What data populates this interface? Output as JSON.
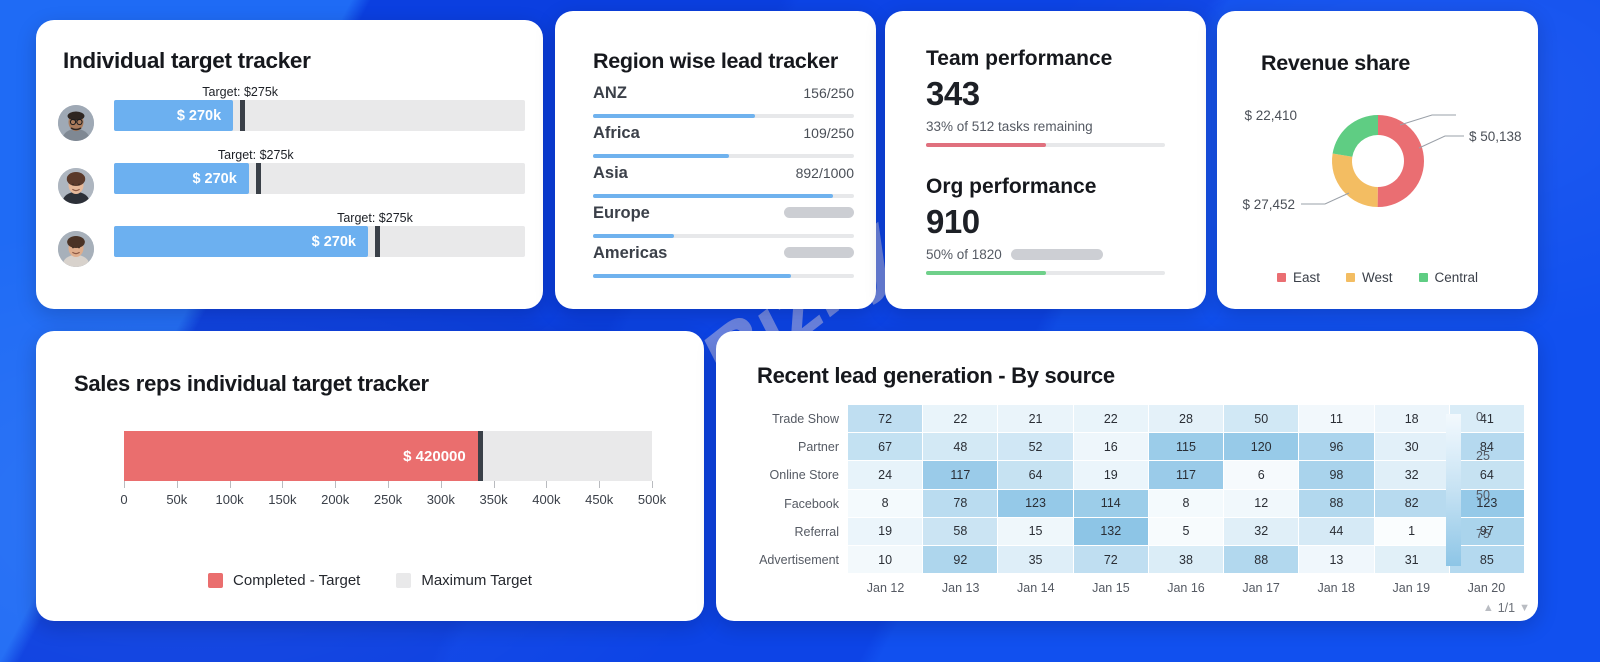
{
  "watermark": "Bizfly",
  "theme": {
    "bg_blue": "#0b45e8",
    "blue_bar": "#6cb0f0",
    "red_bar": "#ea6e6e",
    "green_bar": "#6fd08a",
    "track_grey": "#e9e9ea",
    "marker_dark": "#3a4048"
  },
  "individual_tracker": {
    "title": "Individual target tracker",
    "rows": [
      {
        "avatar": "avatar-man-glasses",
        "target_label": "Target: $275k",
        "value_label": "$ 270k",
        "fill_pct": 29.0,
        "marker_pct": 30.7
      },
      {
        "avatar": "avatar-woman-dark-blazer",
        "target_label": "Target: $275k",
        "value_label": "$ 270k",
        "fill_pct": 32.8,
        "marker_pct": 34.5
      },
      {
        "avatar": "avatar-woman-smiling",
        "target_label": "Target: $275k",
        "value_label": "$ 270k",
        "fill_pct": 61.8,
        "marker_pct": 63.5
      }
    ]
  },
  "region_tracker": {
    "title": "Region wise lead tracker",
    "rows": [
      {
        "name": "ANZ",
        "value": "156/250",
        "fill_pct": 62,
        "loading": false
      },
      {
        "name": "Africa",
        "value": "109/250",
        "fill_pct": 52,
        "loading": false
      },
      {
        "name": "Asia",
        "value": "892/1000",
        "fill_pct": 92,
        "loading": false
      },
      {
        "name": "Europe",
        "value": "",
        "fill_pct": 31,
        "loading": true
      },
      {
        "name": "Americas",
        "value": "",
        "fill_pct": 76,
        "loading": true
      }
    ]
  },
  "performance": {
    "team": {
      "title": "Team performance",
      "number": "343",
      "subtitle": "33% of 512 tasks remaining",
      "fill_pct": 50,
      "color": "#e0707e",
      "loading": false
    },
    "org": {
      "title": "Org performance",
      "number": "910",
      "subtitle": "50% of 1820",
      "fill_pct": 50,
      "color": "#6fd08a",
      "loading": true
    }
  },
  "revenue_share": {
    "title": "Revenue share",
    "legend": [
      {
        "label": "East",
        "color": "#ea6e72"
      },
      {
        "label": "West",
        "color": "#f3bd62"
      },
      {
        "label": "Central",
        "color": "#5fcd83"
      }
    ],
    "callouts": {
      "east": "$ 50,138",
      "west": "$ 27,452",
      "central": "$ 22,410"
    },
    "chart_data": {
      "type": "pie",
      "title": "Revenue share",
      "categories": [
        "East",
        "West",
        "Central"
      ],
      "values": [
        50138,
        27452,
        22410
      ],
      "labels": [
        "$ 50,138",
        "$ 27,452",
        "$ 22,410"
      ],
      "colors": [
        "#ea6e72",
        "#f3bd62",
        "#5fcd83"
      ],
      "donut": true,
      "legend_position": "bottom"
    }
  },
  "sales_reps": {
    "title": "Sales reps individual target tracker",
    "bar_label": "$ 420000",
    "legend": [
      {
        "label": "Completed - Target",
        "color": "#ea6e6e"
      },
      {
        "label": "Maximum Target",
        "color": "#e9e9ea"
      }
    ],
    "chart_data": {
      "type": "bar",
      "orientation": "horizontal",
      "title": "Sales reps individual target tracker",
      "categories": [
        "Completed - Target"
      ],
      "values": [
        420000
      ],
      "value_labels": [
        "$ 420000"
      ],
      "bar_end_pct": 67,
      "marker_pct": 67,
      "xlim": [
        0,
        500000
      ],
      "xticks": [
        0,
        50000,
        100000,
        150000,
        200000,
        250000,
        300000,
        350000,
        400000,
        450000,
        500000
      ],
      "xticklabels": [
        "0",
        "50k",
        "100k",
        "150k",
        "200k",
        "250k",
        "300k",
        "350k",
        "400k",
        "450k",
        "500k"
      ],
      "ylabel": "",
      "xlabel": "",
      "grid": false,
      "legend_position": "bottom"
    }
  },
  "lead_generation": {
    "title": "Recent lead generation - By source",
    "pager": {
      "up": "▲",
      "text": "1/1",
      "down": "▼"
    },
    "scale": {
      "labels": [
        "0",
        "25",
        "50",
        "75"
      ]
    },
    "chart_data": {
      "type": "heatmap",
      "title": "Recent lead generation - By source",
      "rows": [
        "Trade Show",
        "Partner",
        "Online Store",
        "Facebook",
        "Referral",
        "Advertisement"
      ],
      "columns": [
        "Jan 12",
        "Jan 13",
        "Jan 14",
        "Jan 15",
        "Jan 16",
        "Jan 17",
        "Jan 18",
        "Jan 19",
        "Jan 20"
      ],
      "values": [
        [
          72,
          22,
          21,
          22,
          28,
          50,
          11,
          18,
          41
        ],
        [
          67,
          48,
          52,
          16,
          115,
          120,
          96,
          30,
          84
        ],
        [
          24,
          117,
          64,
          19,
          117,
          6,
          98,
          32,
          64
        ],
        [
          8,
          78,
          123,
          114,
          8,
          12,
          88,
          82,
          123
        ],
        [
          19,
          58,
          15,
          132,
          5,
          32,
          44,
          1,
          97
        ],
        [
          10,
          92,
          35,
          72,
          38,
          88,
          13,
          31,
          85
        ]
      ],
      "colorbar_ticks": [
        0,
        25,
        50,
        75
      ],
      "colorbar_range": [
        0,
        100
      ],
      "colormap": "light-blue",
      "xlabel": "",
      "ylabel": ""
    }
  }
}
